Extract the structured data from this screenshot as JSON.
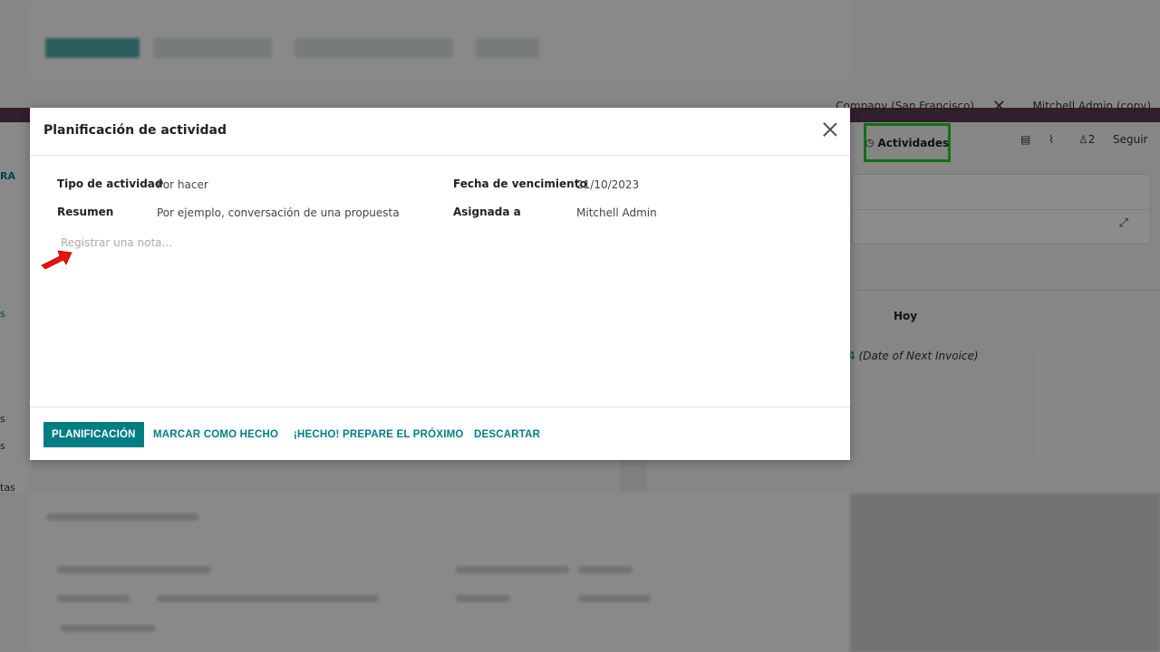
{
  "modal": {
    "title": "Planificación de actividad",
    "fields": {
      "activity_type_label": "Tipo de actividad",
      "activity_type_value": "Por hacer",
      "summary_label": "Resumen",
      "summary_placeholder": "Por ejemplo, conversación de una propuesta",
      "due_date_label": "Fecha de vencimiento",
      "due_date_value": "21/10/2023",
      "assigned_label": "Asignada a",
      "assigned_value": "Mitchell Admin"
    },
    "note_placeholder": "Registrar una nota...",
    "footer": {
      "schedule": "PLANIFICACIÓN",
      "mark_done": "MARCAR COMO HECHO",
      "done_next": "¡HECHO! PREPARE EL PRÓXIMO",
      "discard": "DESCARTAR"
    }
  },
  "background": {
    "company": "Company (San Francisco)",
    "user": "Mitchell Admin (copy)",
    "activities_button": "Actividades",
    "followers_count": "2",
    "follow": "Seguir",
    "today": "Hoy",
    "next_invoice": "(Date of Next Invoice)",
    "left_tab": "RA",
    "left_frag_1": "s",
    "left_frag_2": "s",
    "left_frag_3": "s",
    "left_frag_4": "tas"
  },
  "colors": {
    "primary": "#017e84",
    "highlight": "#22d01e",
    "arrow": "#e8150f"
  }
}
